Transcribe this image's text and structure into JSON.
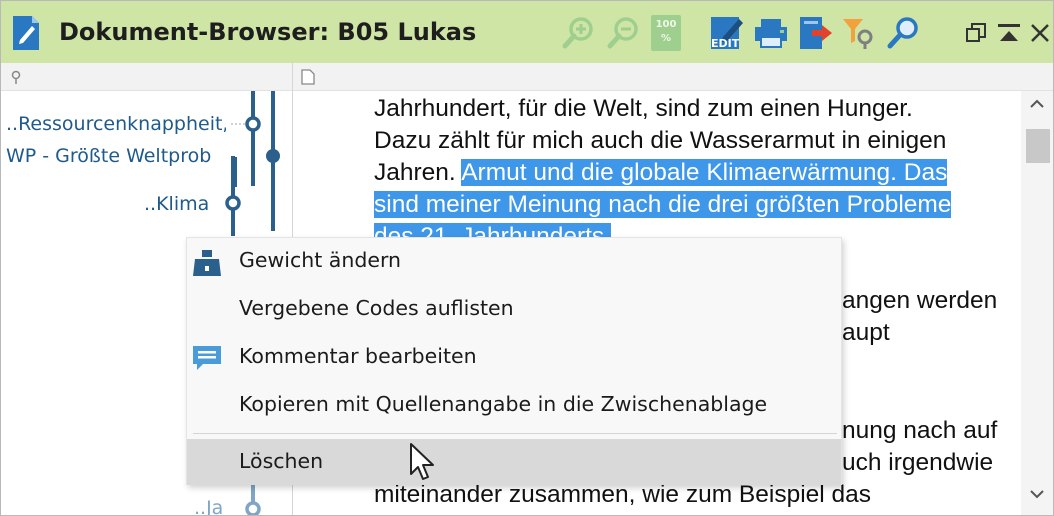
{
  "window": {
    "title": "Dokument-Browser: B05 Lukas"
  },
  "toolbar": {
    "icons": [
      "zoom-in-icon",
      "zoom-out-icon",
      "zoom-100-icon",
      "edit-icon",
      "print-icon",
      "export-icon",
      "filter-icon",
      "search-icon"
    ],
    "edit_badge": "EDIT",
    "zoom_badge": "100 %",
    "window_controls": [
      "restore-window-icon",
      "collapse-icon",
      "close-icon"
    ]
  },
  "codes": [
    {
      "label": "..Ressourcenknappheit, Gesellschaft"
    },
    {
      "label": "WP - Größte Weltprobleme"
    },
    {
      "label": "..Klima"
    },
    {
      "label": "..Ja"
    }
  ],
  "document": {
    "line1": "Jahrhundert, für die Welt, sind zum einen Hunger.",
    "line2": "Dazu zählt für mich auch die Wasserarmut in einigen",
    "line3_plain": "Jahren. ",
    "line3_sel": "Armut und die globale Klimaerwärmung. Das",
    "line4_sel": "sind meiner Meinung nach die drei größten Probleme",
    "line5_sel": "des 21. Jahrhunderts.",
    "frag1": "angen werden",
    "frag2": "aupt",
    "frag3": "nung nach auf",
    "frag4": "uch irgendwie",
    "last_line": "miteinander zusammen, wie zum Beispiel das"
  },
  "context_menu": {
    "items": [
      {
        "label": "Gewicht ändern",
        "icon": "weight-icon"
      },
      {
        "label": "Vergebene Codes auflisten"
      },
      {
        "label": "Kommentar bearbeiten",
        "icon": "comment-icon"
      },
      {
        "label": "Kopieren mit Quellenangabe in die Zwischenablage"
      },
      {
        "label": "Löschen"
      }
    ]
  },
  "colors": {
    "titlebar": "#cfe5a5",
    "selection": "#3f97e9",
    "code_text": "#1f5a8c",
    "code_stripe": "#2b5f8c",
    "icon_blue": "#2a78c2"
  }
}
